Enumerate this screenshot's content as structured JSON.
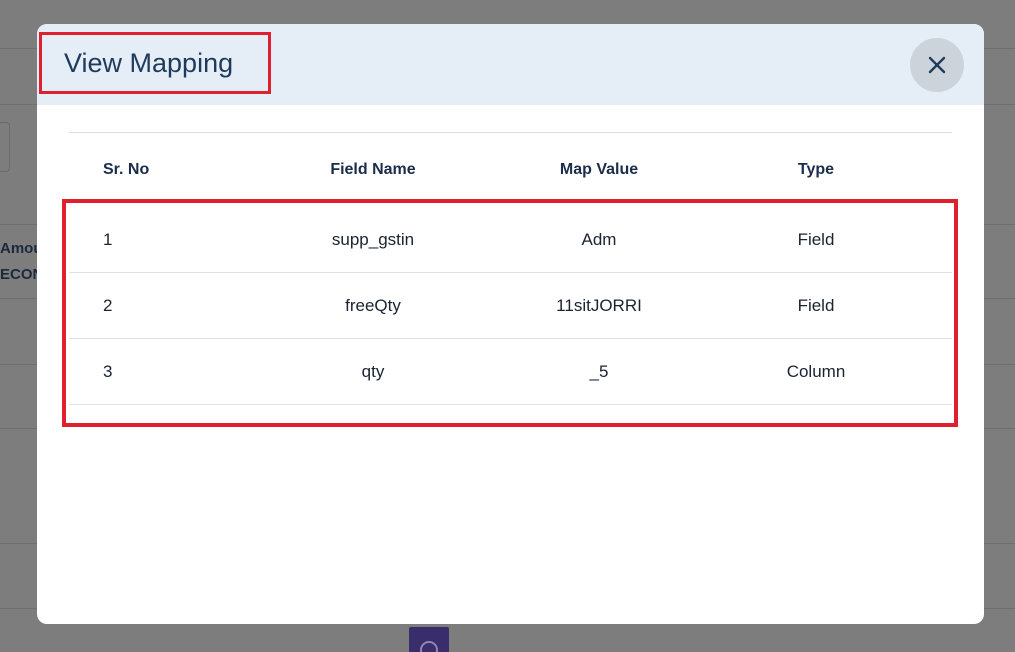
{
  "background": {
    "partial_text_line1": "Amou",
    "partial_text_line2": "ECON"
  },
  "modal": {
    "title": "View Mapping",
    "close_icon": "close-icon"
  },
  "table": {
    "headers": {
      "sr_no": "Sr. No",
      "field_name": "Field Name",
      "map_value": "Map Value",
      "type": "Type"
    },
    "rows": [
      {
        "sr_no": "1",
        "field_name": "supp_gstin",
        "map_value": "Adm",
        "type": "Field"
      },
      {
        "sr_no": "2",
        "field_name": "freeQty",
        "map_value": "11sitJORRI",
        "type": "Field"
      },
      {
        "sr_no": "3",
        "field_name": "qty",
        "map_value": "_5",
        "type": "Column"
      }
    ]
  },
  "colors": {
    "overlay": "#7d7d7d",
    "header_bg": "#e5edf6",
    "title_text": "#1f3b5c",
    "highlight": "#e0202e",
    "close_button_bg": "#cdd3da"
  }
}
